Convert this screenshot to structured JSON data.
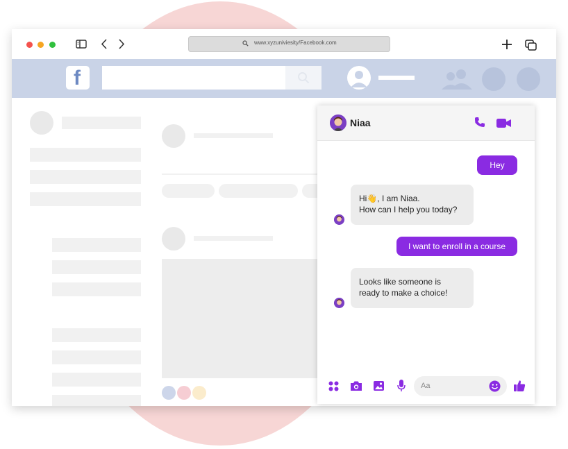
{
  "browser": {
    "url": "www.xyzuniviesity/Facebook.com"
  },
  "chat": {
    "contact_name": "Niaa",
    "messages": {
      "m1": "Hey",
      "m2_line1": "Hi👋, I am Niaa.",
      "m2_line2": "How can I help you today?",
      "m3": "I want to enroll in a course",
      "m4_line1": "Looks like someone is",
      "m4_line2": "ready to make a choice!"
    },
    "input_placeholder": "Aa"
  },
  "colors": {
    "accent": "#8a2be2",
    "fb_bar": "#c9d3e7",
    "background_circle": "#f7d6d5"
  },
  "icons": [
    "sidebar-icon",
    "back-icon",
    "forward-icon",
    "new-tab-icon",
    "tabs-icon",
    "search-icon",
    "phone-icon",
    "video-icon",
    "apps-icon",
    "camera-icon",
    "image-icon",
    "mic-icon",
    "emoji-icon",
    "thumbs-up-icon"
  ]
}
